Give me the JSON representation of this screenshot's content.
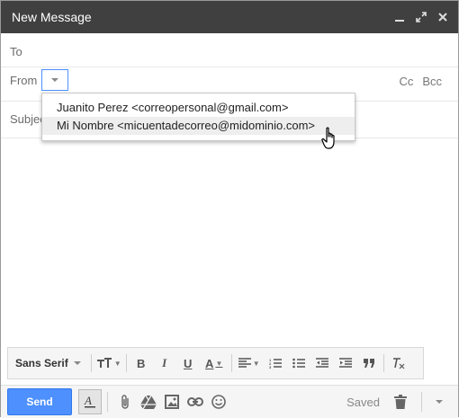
{
  "window": {
    "title": "New Message",
    "controls": [
      "minimize-icon",
      "expand-icon",
      "close-icon"
    ]
  },
  "fields": {
    "to_label": "To",
    "from_label": "From",
    "cc_label": "Cc",
    "bcc_label": "Bcc",
    "subject_label": "Subject"
  },
  "from_dropdown": {
    "options": [
      {
        "label": "Juanito Perez <correopersonal@gmail.com>",
        "hovered": false
      },
      {
        "label": "Mi Nombre <micuentadecorreo@midominio.com>",
        "hovered": true
      }
    ]
  },
  "format_toolbar": {
    "font_label": "Sans Serif",
    "size_icon": "text-size-icon",
    "bold_label": "B",
    "italic_label": "I",
    "underline_label": "U",
    "color_label": "A",
    "tools": [
      "text-size-icon",
      "bold-icon",
      "italic-icon",
      "underline-icon",
      "text-color-icon",
      "align-icon",
      "numbered-list-icon",
      "bulleted-list-icon",
      "indent-less-icon",
      "indent-more-icon",
      "quote-icon",
      "remove-formatting-icon"
    ]
  },
  "bottom_bar": {
    "send_label": "Send",
    "saved_label": "Saved",
    "icons": [
      "formatting-options-icon",
      "attach-icon",
      "drive-icon",
      "photo-icon",
      "link-icon",
      "emoji-icon",
      "trash-icon",
      "more-options-icon"
    ]
  },
  "colors": {
    "titlebar": "#404040",
    "send_button": "#4d90fe",
    "dropdown_hover": "#eeeeee"
  }
}
